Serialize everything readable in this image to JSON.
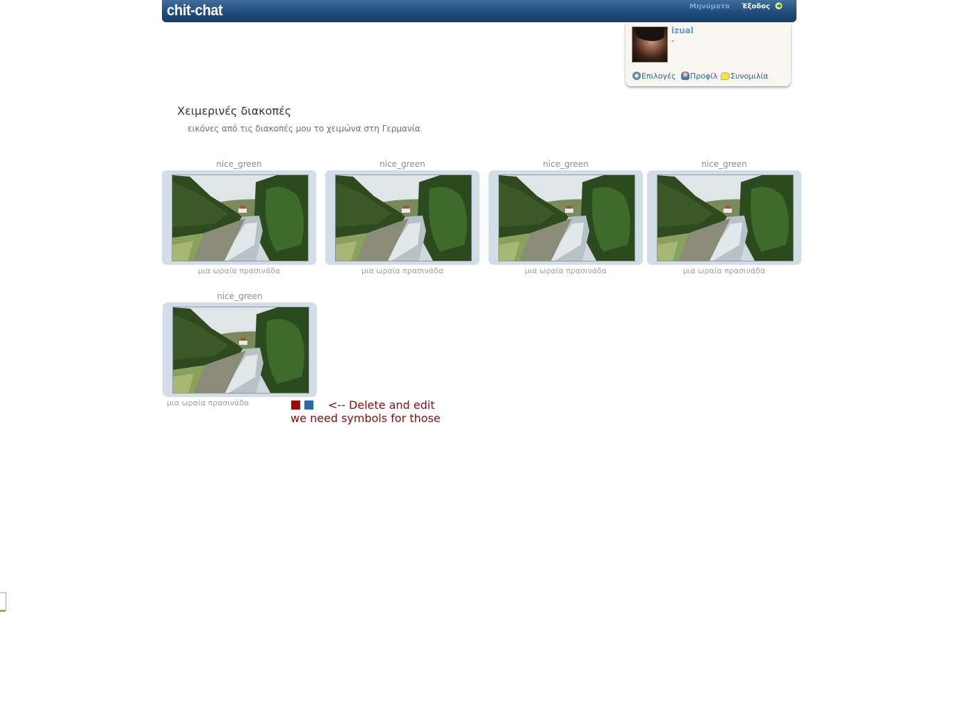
{
  "header": {
    "logo": "chit-chat",
    "messages_label": "Μηνύματα",
    "logout_label": "Έξοδος"
  },
  "user": {
    "name": "izual",
    "status": "-",
    "links": {
      "options": "Επιλογές",
      "profile": "Προφίλ",
      "chat": "Συνομιλία"
    }
  },
  "album": {
    "title": "Χειμερινές διακοπές",
    "description": "εικόνες από τις διακοπές μου το χειμώνα στη Γερμανία",
    "photos": [
      {
        "name": "nice_green",
        "caption": "μια ωραία πρασινάδα"
      },
      {
        "name": "nice_green",
        "caption": "μια ωραία πρασινάδα"
      },
      {
        "name": "nice_green",
        "caption": "μια ωραία πρασινάδα"
      },
      {
        "name": "nice_green",
        "caption": "μια ωραία πρασινάδα"
      },
      {
        "name": "nice_green",
        "caption": "μια ωραία πρασινάδα"
      }
    ]
  },
  "annotation": {
    "line1": "<-- Delete and edit",
    "line2": "we need symbols for those"
  },
  "colors": {
    "header_blue": "#1d4a78",
    "frame": "#d2dde8",
    "delete_red": "#a20b0b",
    "edit_blue": "#2d6aa3",
    "note_red": "#8a0c0c"
  }
}
